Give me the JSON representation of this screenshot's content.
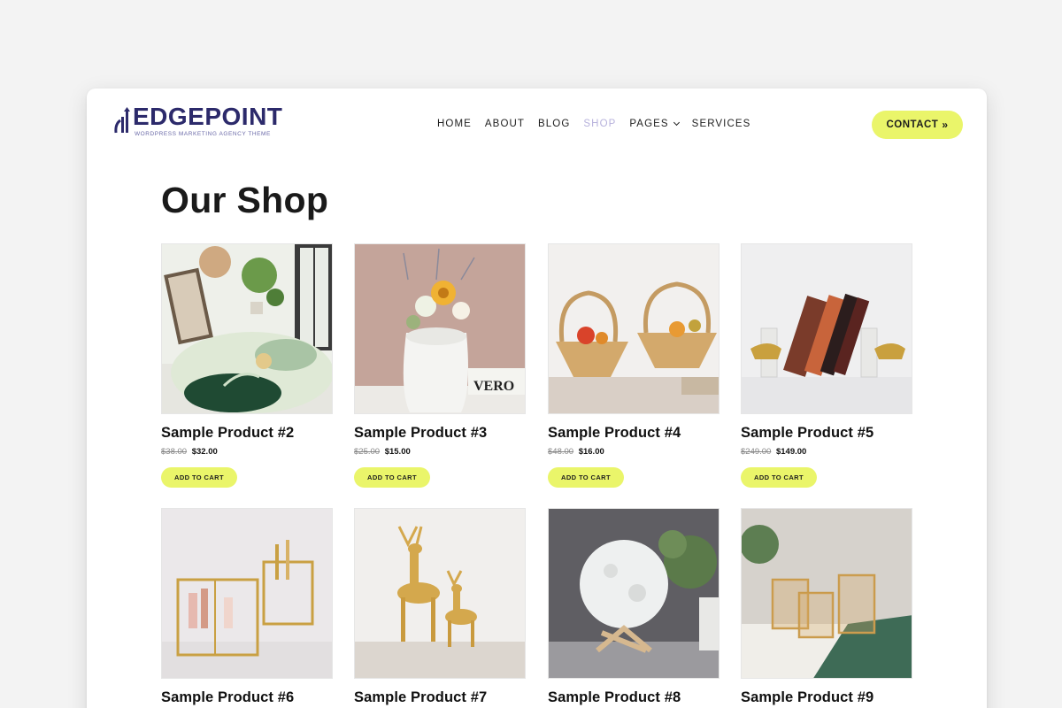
{
  "brand": {
    "name": "EDGEPOINT",
    "tagline": "WORDPRESS MARKETING AGENCY THEME",
    "color": "#2c2a6b"
  },
  "nav": {
    "items": [
      {
        "label": "HOME"
      },
      {
        "label": "ABOUT"
      },
      {
        "label": "BLOG"
      },
      {
        "label": "SHOP",
        "active": true
      },
      {
        "label": "PAGES",
        "dropdown": true
      },
      {
        "label": "SERVICES"
      }
    ]
  },
  "header": {
    "contact_label": "CONTACT",
    "contact_icon": "double-chevron-right-icon"
  },
  "page": {
    "title": "Our Shop"
  },
  "products": [
    {
      "title": "Sample Product #2",
      "old_price": "$38.00",
      "price": "$32.00",
      "cta": "ADD TO CART"
    },
    {
      "title": "Sample Product #3",
      "old_price": "$25.00",
      "price": "$15.00",
      "cta": "ADD TO CART"
    },
    {
      "title": "Sample Product #4",
      "old_price": "$48.00",
      "price": "$16.00",
      "cta": "ADD TO CART"
    },
    {
      "title": "Sample Product #5",
      "old_price": "$249.00",
      "price": "$149.00",
      "cta": "ADD TO CART"
    },
    {
      "title": "Sample Product #6"
    },
    {
      "title": "Sample Product #7"
    },
    {
      "title": "Sample Product #8"
    },
    {
      "title": "Sample Product #9"
    }
  ],
  "colors": {
    "accent": "#eaf56a",
    "active_nav": "#b7b2dc",
    "background": "#f3f3f3"
  }
}
